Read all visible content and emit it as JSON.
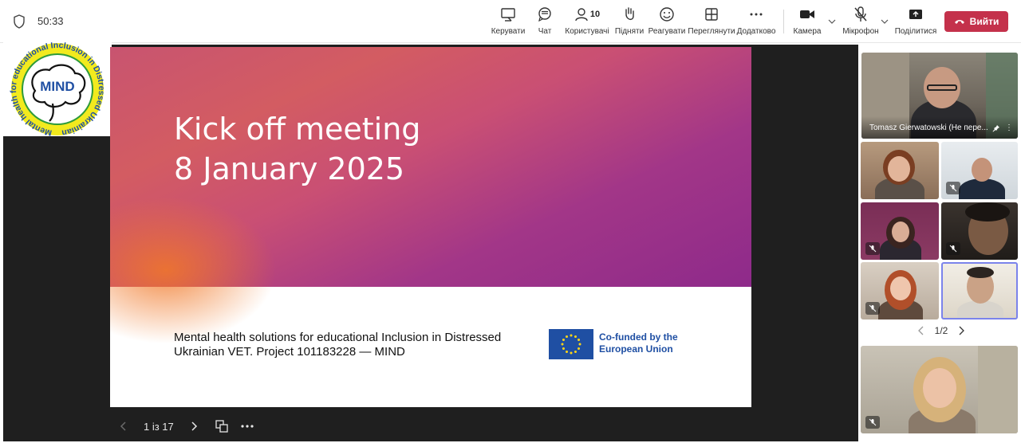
{
  "header": {
    "timer": "50:33",
    "controls": [
      {
        "id": "control",
        "label": "Керувати",
        "icon": "share-screen-icon"
      },
      {
        "id": "chat",
        "label": "Чат",
        "icon": "chat-icon"
      },
      {
        "id": "people",
        "label": "Користувачі",
        "icon": "people-icon",
        "count": "10"
      },
      {
        "id": "raise",
        "label": "Підняти",
        "icon": "raise-hand-icon"
      },
      {
        "id": "react",
        "label": "Реагувати",
        "icon": "smile-icon"
      },
      {
        "id": "view",
        "label": "Переглянути",
        "icon": "grid-icon"
      },
      {
        "id": "more",
        "label": "Додатково",
        "icon": "more-icon"
      },
      {
        "id": "camera",
        "label": "Камера",
        "icon": "camera-icon"
      },
      {
        "id": "mic",
        "label": "Мікрофон",
        "icon": "mic-off-icon"
      },
      {
        "id": "share",
        "label": "Поділитися",
        "icon": "share-icon"
      }
    ],
    "leave_label": "Вийти"
  },
  "logo": {
    "title": "MIND",
    "ring_text": "Mental health for educational Inclusion in Distressed Ukrainian VET"
  },
  "slide": {
    "title_line1": "Kick off meeting",
    "title_line2": "8 January 2025",
    "subtitle": "Mental health solutions for educational Inclusion in Distressed Ukrainian VET. Project 101183228 — MIND",
    "eu_text": "Co-funded by the European Union",
    "position": "1 із 17"
  },
  "participants": {
    "pinned_name": "Tomasz Gierwatowski (Не пере...",
    "page": "1/2"
  },
  "colors": {
    "leave": "#c4314b",
    "eu_blue": "#1f4fa3",
    "stage": "#1f1f1f",
    "active_border": "#7b83eb"
  }
}
